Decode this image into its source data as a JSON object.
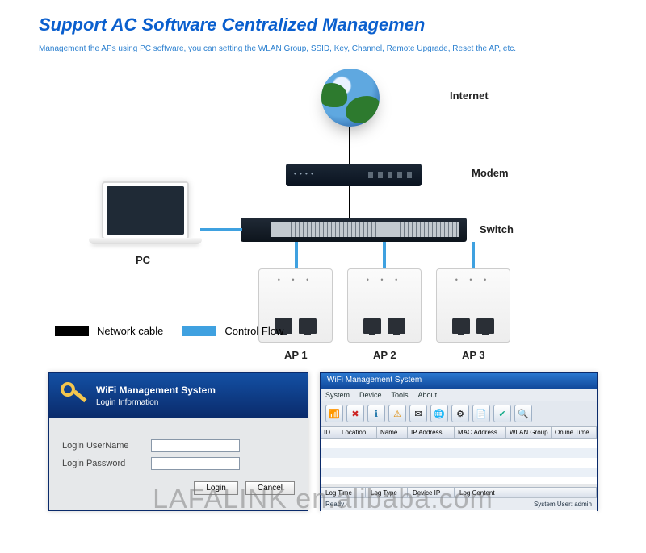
{
  "title": "Support AC Software Centralized Managemen",
  "subtitle": "Management the APs using PC software, you can setting the WLAN Group, SSID, Key, Channel, Remote Upgrade, Reset the AP, etc.",
  "labels": {
    "internet": "Internet",
    "modem": "Modem",
    "switch": "Switch",
    "pc": "PC",
    "ap1": "AP 1",
    "ap2": "AP 2",
    "ap3": "AP 3"
  },
  "legend": {
    "network_cable": "Network cable",
    "control_flow": "Control Flow"
  },
  "login": {
    "title": "WiFi Management System",
    "subtitle": "Login Information",
    "username_label": "Login UserName",
    "password_label": "Login   Password",
    "btn_login": "Login",
    "btn_cancel": "Cancel"
  },
  "mgmt": {
    "title": "WiFi Management System",
    "menu": [
      "System",
      "Device",
      "Tools",
      "About"
    ],
    "columns": [
      "ID",
      "Location",
      "Name",
      "IP Address",
      "MAC Address",
      "WLAN Group",
      "Online Time"
    ],
    "log_columns": [
      "Log Time",
      "Log Type",
      "Device IP",
      "Log Content"
    ],
    "status_left": "Ready",
    "status_right": "System User: admin"
  },
  "watermark": "LAFALINK en.alibaba.com",
  "icons": {
    "wifi": "📶",
    "close": "✖",
    "info": "ℹ",
    "warn": "⚠",
    "mail": "✉",
    "globe": "🌐",
    "gear": "⚙",
    "doc": "📄",
    "check": "✔",
    "plus": "🔍"
  }
}
